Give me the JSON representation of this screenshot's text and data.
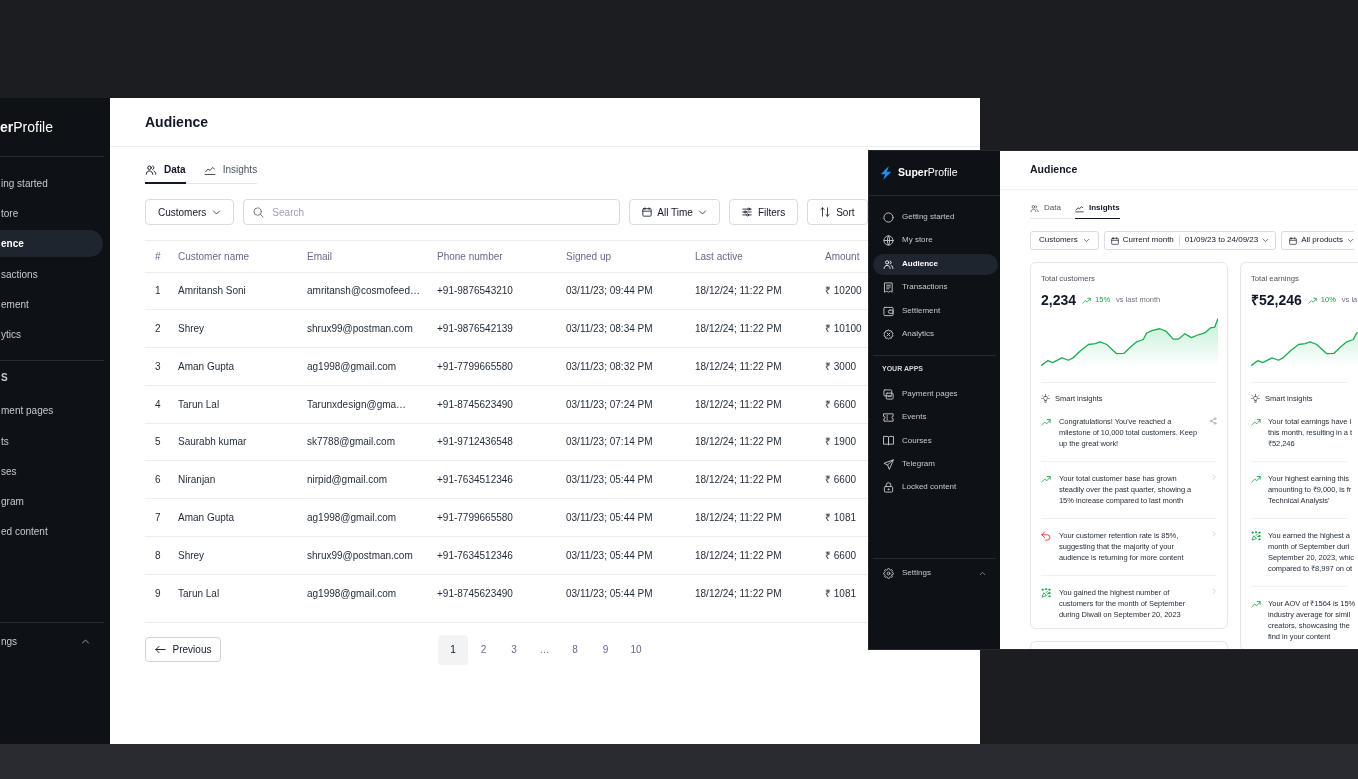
{
  "back_window": {
    "sidebar": {
      "logo": "**er**Profile",
      "items": [
        {
          "label": "ing started",
          "selected": false
        },
        {
          "label": "tore",
          "selected": false
        },
        {
          "label": "ence",
          "selected": true
        },
        {
          "label": "sactions",
          "selected": false
        },
        {
          "label": "ement",
          "selected": false
        },
        {
          "label": "ytics",
          "selected": false
        }
      ],
      "section_label": "S",
      "apps": [
        {
          "label": "ment pages",
          "selected": false
        },
        {
          "label": "ts",
          "selected": false
        },
        {
          "label": "ses",
          "selected": false
        },
        {
          "label": "gram",
          "selected": false
        },
        {
          "label": "ed content",
          "selected": false
        }
      ],
      "settings": {
        "label": "ngs",
        "expanded": true
      }
    },
    "page_title": "Audience",
    "tabs": [
      {
        "label": "Data",
        "selected": true
      },
      {
        "label": "Insights",
        "selected": false
      }
    ],
    "toolbar": {
      "segment": "Customers",
      "search": {
        "placeholder": "Search"
      },
      "date_filter": "All Time",
      "filters": "Filters",
      "sort": "Sort"
    },
    "table": {
      "columns": [
        "#",
        "Customer name",
        "Email",
        "Phone number",
        "Signed up",
        "Last active",
        "Amount"
      ],
      "rows": [
        [
          "1",
          "Amritansh Soni",
          "amritansh@cosmofeed…",
          "+91-9876543210",
          "03/11/23; 09:44 PM",
          "18/12/24; 11:22 PM",
          "₹ 10200"
        ],
        [
          "2",
          "Shrey",
          "shrux99@postman.com",
          "+91-9876542139",
          "03/11/23; 08:34 PM",
          "18/12/24; 11:22 PM",
          "₹ 10100"
        ],
        [
          "3",
          "Aman Gupta",
          "ag1998@gmail.com",
          "+91-7799665580",
          "03/11/23; 08:32 PM",
          "18/12/24; 11:22 PM",
          "₹ 3000"
        ],
        [
          "4",
          "Tarun Lal",
          "Tarunxdesign@gma…",
          "+91-8745623490",
          "03/11/23; 07:24 PM",
          "18/12/24; 11:22 PM",
          "₹ 6600"
        ],
        [
          "5",
          "Saurabh kumar",
          "sk7788@gmail.com",
          "+91-9712436548",
          "03/11/23; 07:14 PM",
          "18/12/24; 11:22 PM",
          "₹ 1900"
        ],
        [
          "6",
          "Niranjan",
          "nirpid@gmail.com",
          "+91-7634512346",
          "03/11/23; 05:44 PM",
          "18/12/24; 11:22 PM",
          "₹ 6600"
        ],
        [
          "7",
          "Aman Gupta",
          "ag1998@gmail.com",
          "+91-7799665580",
          "03/11/23; 05:44 PM",
          "18/12/24; 11:22 PM",
          "₹ 1081"
        ],
        [
          "8",
          "Shrey",
          "shrux99@postman.com",
          "+91-7634512346",
          "03/11/23; 05:44 PM",
          "18/12/24; 11:22 PM",
          "₹ 6600"
        ],
        [
          "9",
          "Tarun Lal",
          "ag1998@gmail.com",
          "+91-8745623490",
          "03/11/23; 05:44 PM",
          "18/12/24; 11:22 PM",
          "₹ 1081"
        ]
      ]
    },
    "pagination": {
      "previous": "Previous",
      "pages": [
        {
          "label": "1",
          "selected": true
        },
        {
          "label": "2",
          "selected": false
        },
        {
          "label": "3",
          "selected": false
        },
        {
          "label": "…",
          "selected": false
        },
        {
          "label": "8",
          "selected": false
        },
        {
          "label": "9",
          "selected": false
        },
        {
          "label": "10",
          "selected": false
        }
      ]
    }
  },
  "front_window": {
    "sidebar": {
      "logo": "**Super**Profile",
      "items": [
        {
          "label": "Getting started",
          "selected": false
        },
        {
          "label": "My store",
          "selected": false
        },
        {
          "label": "Audience",
          "selected": true
        },
        {
          "label": "Transactions",
          "selected": false
        },
        {
          "label": "Settlement",
          "selected": false
        },
        {
          "label": "Analytics",
          "selected": false
        }
      ],
      "section_label": "YOUR APPS",
      "apps": [
        {
          "label": "Payment pages",
          "selected": false
        },
        {
          "label": "Events",
          "selected": false
        },
        {
          "label": "Courses",
          "selected": false
        },
        {
          "label": "Telegram",
          "selected": false
        },
        {
          "label": "Locked content",
          "selected": false
        }
      ],
      "settings": {
        "label": "Settings",
        "expanded": true
      }
    },
    "page_title": "Audience",
    "tabs": [
      {
        "label": "Data",
        "selected": false
      },
      {
        "label": "Insights",
        "selected": true
      }
    ],
    "toolbar": {
      "segment": "Customers",
      "period": "Current month",
      "date_range": "01/09/23 to 24/09/23",
      "products": "All products"
    },
    "cards": [
      {
        "title": "Total customers",
        "value": "2,234",
        "change": "15%",
        "comparison": "vs last month",
        "insights_title": "Smart insights",
        "insights": [
          {
            "kind": "growth",
            "text": "Congratulations! You've reached a milestone of 10,000 total customers. Keep up the great work!",
            "shareable": true
          },
          {
            "kind": "growth",
            "text": "Your total customer base has grown steadily over the past quarter, showing a 15% increase compared to last month",
            "shareable": false
          },
          {
            "kind": "decline",
            "text": "Your customer retention rate is 85%, suggesting that the majority of your audience is returning for more content",
            "shareable": false
          },
          {
            "kind": "highlight",
            "text": "You gained the highest number of customers for the month of September during Diwali on September 20, 2023",
            "shareable": false
          }
        ]
      },
      {
        "title": "Total earnings",
        "value": "₹52,246",
        "change": "10%",
        "comparison": "vs la",
        "insights_title": "Smart insights",
        "insights": [
          {
            "kind": "growth",
            "lines": [
              "Your total earnings have i",
              "this month, resulting in a t",
              "₹52,246"
            ]
          },
          {
            "kind": "growth",
            "lines": [
              "Your highest earning this",
              "amounting to ₹9,000, is fr",
              "Technical Analysis'"
            ]
          },
          {
            "kind": "highlight",
            "lines": [
              "You earned the highest a",
              "month of September duri",
              "September 20, 2023, whic",
              "compared to ₹8,997 on ot"
            ]
          },
          {
            "kind": "growth",
            "lines": [
              "Your AOV of ₹1564 is 15%",
              "industry average for simil",
              "creators, showcasing the",
              "find in your content"
            ]
          }
        ]
      }
    ]
  }
}
